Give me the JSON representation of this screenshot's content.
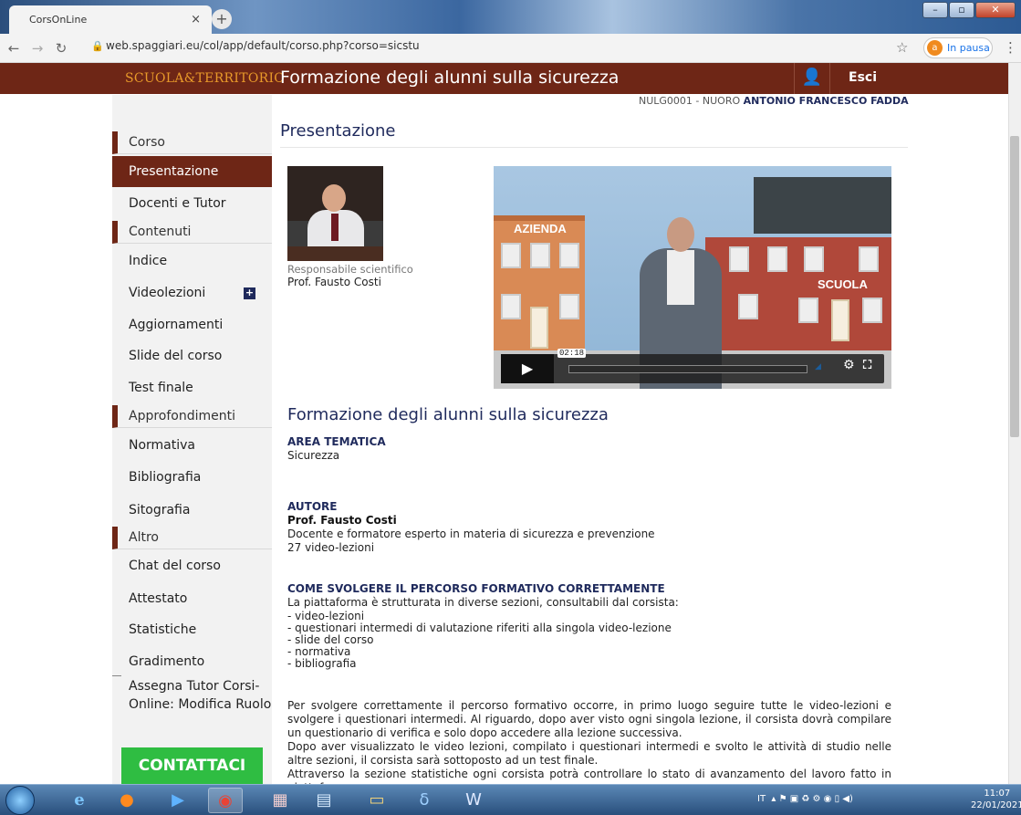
{
  "browser": {
    "tab_title": "CorsOnLine",
    "tab_close": "×",
    "new_tab": "+",
    "url": "web.spaggiari.eu/col/app/default/corso.php?corso=sicstu",
    "profile_badge": "a",
    "profile_status": "In pausa"
  },
  "header": {
    "logo": "SCUOLA&TERRITORIO",
    "course_title": "Formazione degli alunni sulla sicurezza",
    "logout": "Esci",
    "user_prefix": "NULG0001 - NUORO ",
    "user_name": "ANTONIO FRANCESCO FADDA"
  },
  "sidebar": {
    "sec_corso": "Corso",
    "presentazione": "Presentazione",
    "docenti": "Docenti e Tutor",
    "sec_contenuti": "Contenuti",
    "indice": "Indice",
    "videolezioni": "Videolezioni",
    "aggiornamenti": "Aggiornamenti",
    "slide": "Slide del corso",
    "test": "Test finale",
    "sec_approfondimenti": "Approfondimenti",
    "normativa": "Normativa",
    "bibliografia": "Bibliografia",
    "sitografia": "Sitografia",
    "sec_altro": "Altro",
    "chat": "Chat del corso",
    "attestato": "Attestato",
    "statistiche": "Statistiche",
    "gradimento": "Gradimento",
    "assegna_1": "Assegna Tutor Corsi-",
    "assegna_2": "Online: Modifica Ruolo",
    "contattaci": "CONTATTACI"
  },
  "main": {
    "heading": "Presentazione",
    "resp_label": "Responsabile scientifico",
    "resp_name": "Prof. Fausto Costi",
    "video": {
      "label_azienda": "AZIENDA",
      "label_scuola": "SCUOLA",
      "time": "02:18",
      "progress": 0.0
    },
    "section_title": "Formazione degli alunni sulla sicurezza",
    "area_label": "AREA TEMATICA",
    "area_value": "Sicurezza",
    "autore_label": "AUTORE",
    "autore_name": "Prof. Fausto Costi",
    "autore_desc": "Docente e formatore esperto in materia di sicurezza e prevenzione",
    "autore_count": "27 video-lezioni",
    "come_label": "COME SVOLGERE IL PERCORSO FORMATIVO CORRETTAMENTE",
    "come_intro": "La piattaforma è strutturata in diverse sezioni, consultabili dal corsista:",
    "come_list": [
      "-  video-lezioni",
      "-  questionari intermedi di valutazione riferiti alla singola video-lezione",
      "-  slide del corso",
      "-  normativa",
      "-  bibliografia"
    ],
    "para1": "Per svolgere correttamente il percorso formativo occorre, in primo luogo seguire tutte le video-lezioni e svolgere i questionari intermedi. Al riguardo, dopo aver visto ogni singola lezione, il corsista dovrà compilare un questionario di verifica e solo dopo accedere alla lezione successiva.",
    "para2": "Dopo aver visualizzato le video lezioni, compilato i questionari intermedi e svolto le attività di studio nelle altre sezioni, il corsista sarà sottoposto ad un test finale.",
    "para3": "Attraverso la sezione statistiche ogni corsista potrà controllare lo stato di avanzamento del lavoro fatto in piattaforma."
  },
  "taskbar": {
    "lang": "IT",
    "time": "11:07",
    "date": "22/01/2021"
  }
}
